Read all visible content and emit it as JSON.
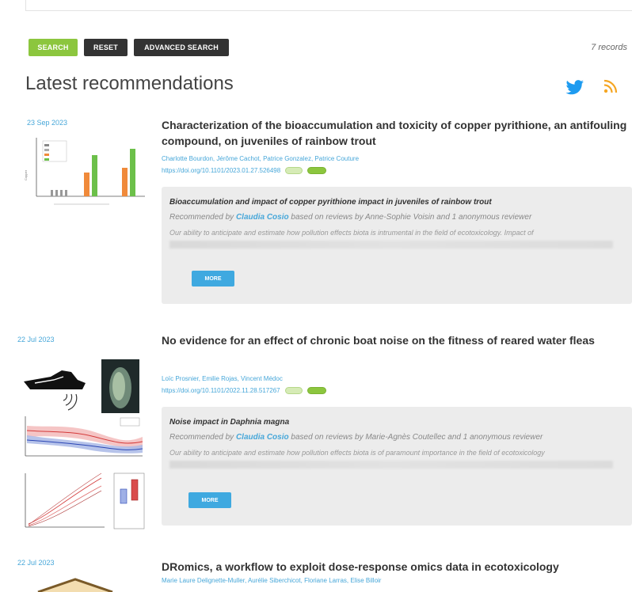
{
  "search": {
    "search_label": "SEARCH",
    "reset_label": "RESET",
    "advanced_label": "ADVANCED SEARCH",
    "records_text": "7 records"
  },
  "section": {
    "title": "Latest recommendations"
  },
  "colors": {
    "accent_blue": "#47a7d9",
    "search_green": "#8cc63e",
    "twitter": "#1d9bf0",
    "rss": "#f5a623"
  },
  "recommendations": [
    {
      "date": "23 Sep 2023",
      "title": "Characterization of the bioaccumulation and toxicity of copper pyrithione, an antifouling compound, on juveniles of rainbow trout",
      "authors": "Charlotte Bourdon, Jérôme Cachot, Patrice Gonzalez, Patrice Couture",
      "doi": "https://doi.org/10.1101/2023.01.27.526498",
      "rec_title": "Bioaccumulation and impact of copper pyrithione impact in juveniles of rainbow trout",
      "rec_by_prefix": "Recommended by ",
      "recommender": "Claudia Cosio",
      "rec_by_suffix": " based on reviews by Anne-Sophie Voisin and 1 anonymous reviewer",
      "summary": "Our ability to anticipate and estimate how pollution effects biota is intrumental in the field of ecotoxicology. Impact of",
      "more_label": "MORE"
    },
    {
      "date": "22 Jul 2023",
      "title": "No evidence for an effect of chronic boat noise on the fitness of reared water fleas",
      "authors": "Loïc Prosnier, Emilie Rojas, Vincent Médoc",
      "doi": "https://doi.org/10.1101/2022.11.28.517267",
      "rec_title": "Noise impact in Daphnia magna",
      "rec_by_prefix": "Recommended by ",
      "recommender": "Claudia Cosio",
      "rec_by_suffix": " based on reviews by Marie-Agnès Coutellec and 1 anonymous reviewer",
      "summary": "Our ability to anticipate and estimate how pollution effects biota is of paramount importance in the field of ecotoxicology",
      "more_label": "MORE"
    },
    {
      "date": "22 Jul 2023",
      "title": "DRomics, a workflow to exploit dose-response omics data in ecotoxicology",
      "authors": "Marie Laure Delignette-Muller, Aurélie Siberchicot, Floriane Larras, Elise Billoir"
    }
  ]
}
